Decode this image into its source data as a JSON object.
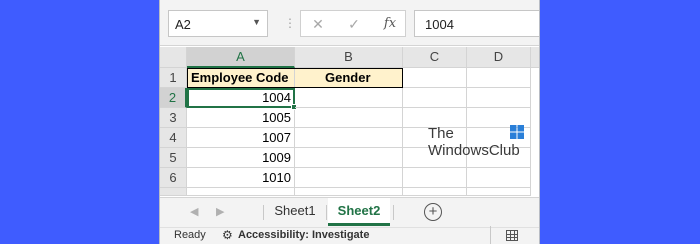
{
  "name_box": {
    "value": "A2"
  },
  "formula_bar": {
    "cancel_icon": "✕",
    "enter_icon": "✓",
    "fx_label": "fx",
    "value": "1004"
  },
  "columns": [
    "A",
    "B",
    "C",
    "D"
  ],
  "rows": [
    "1",
    "2",
    "3",
    "4",
    "5",
    "6"
  ],
  "cells": {
    "A1": "Employee Code",
    "B1": "Gender",
    "A2": "1004",
    "A3": "1005",
    "A4": "1007",
    "A5": "1009",
    "A6": "1010"
  },
  "watermark": {
    "line1": "The",
    "line2": "WindowsClub"
  },
  "sheets": [
    "Sheet1",
    "Sheet2"
  ],
  "active_sheet": "Sheet2",
  "status": {
    "ready": "Ready",
    "accessibility": "Accessibility: Investigate"
  },
  "colors": {
    "accent": "#217346",
    "header_fill": "#fff2cc",
    "background": "#3f5cff"
  }
}
